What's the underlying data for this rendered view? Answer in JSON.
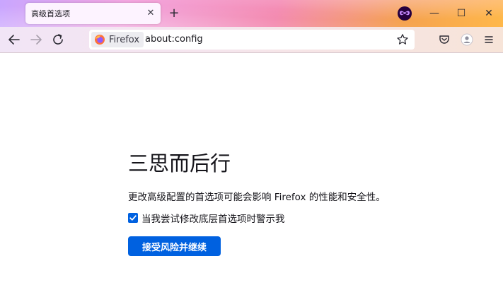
{
  "tab": {
    "title": "高级首选项",
    "close_glyph": "✕"
  },
  "new_tab_glyph": "+",
  "window_controls": {
    "minimize": "—",
    "maximize": "☐",
    "close": "✕"
  },
  "urlbar": {
    "identity_label": "Firefox",
    "url": "about:config"
  },
  "content": {
    "title": "三思而后行",
    "description": "更改高级配置的首选项可能会影响 Firefox 的性能和安全性。",
    "checkbox_label": "当我尝试修改底层首选项时警示我",
    "checkbox_checked": true,
    "accept_button": "接受风险并继续"
  },
  "colors": {
    "accent": "#0061e0",
    "text": "#15141a"
  }
}
